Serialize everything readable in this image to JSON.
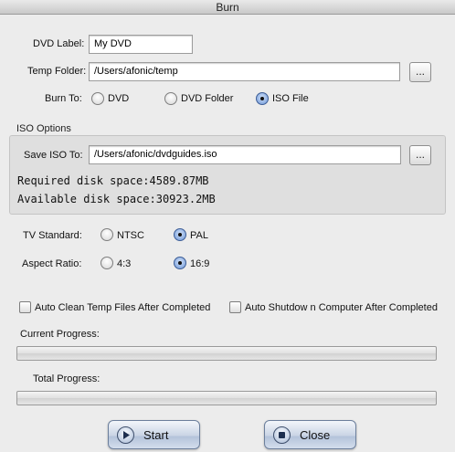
{
  "window": {
    "title": "Burn"
  },
  "dvd_label": {
    "label": "DVD Label:",
    "value": "My DVD"
  },
  "temp_folder": {
    "label": "Temp Folder:",
    "value": "/Users/afonic/temp",
    "browse_label": "..."
  },
  "burn_to": {
    "label": "Burn To:",
    "options": [
      {
        "label": "DVD",
        "selected": false
      },
      {
        "label": "DVD Folder",
        "selected": false
      },
      {
        "label": "ISO File",
        "selected": true
      }
    ]
  },
  "iso_options": {
    "section_title": "ISO Options",
    "save_label": "Save ISO To:",
    "save_value": "/Users/afonic/dvdguides.iso",
    "browse_label": "...",
    "required_space": "Required disk space:4589.87MB",
    "available_space": "Available disk space:30923.2MB"
  },
  "tv_standard": {
    "label": "TV Standard:",
    "options": [
      {
        "label": "NTSC",
        "selected": false
      },
      {
        "label": "PAL",
        "selected": true
      }
    ]
  },
  "aspect_ratio": {
    "label": "Aspect Ratio:",
    "options": [
      {
        "label": "4:3",
        "selected": false
      },
      {
        "label": "16:9",
        "selected": true
      }
    ]
  },
  "checkboxes": {
    "auto_clean": {
      "label": "Auto Clean Temp Files After Completed",
      "checked": false
    },
    "auto_shutdown": {
      "label": "Auto Shutdow n Computer After Completed",
      "checked": false
    }
  },
  "progress": {
    "current_label": "Current Progress:",
    "current_value": 0,
    "total_label": "Total Progress:",
    "total_value": 0
  },
  "buttons": {
    "start_label": "Start",
    "close_label": "Close"
  }
}
